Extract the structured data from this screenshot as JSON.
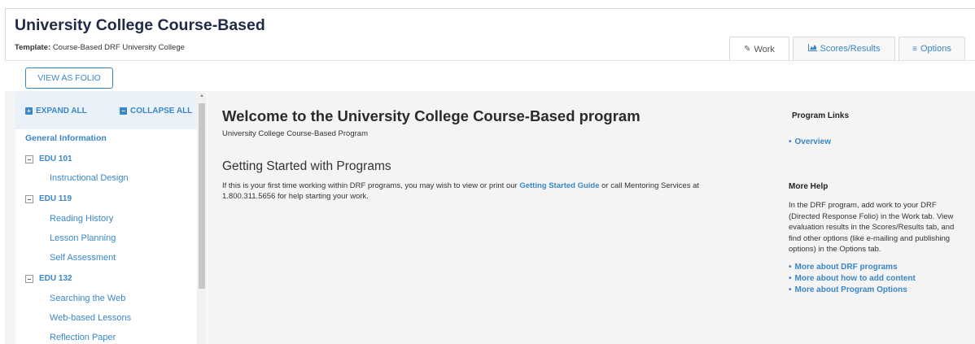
{
  "header": {
    "title": "University College Course-Based",
    "template_label": "Template:",
    "template_value": "Course-Based DRF University College"
  },
  "tabs": [
    {
      "icon": "edit-icon",
      "label": "Work"
    },
    {
      "icon": "chart-icon",
      "label": "Scores/Results"
    },
    {
      "icon": "menu-icon",
      "label": "Options"
    }
  ],
  "toolbar": {
    "view_folio": "VIEW AS FOLIO"
  },
  "sidebar": {
    "expand_all": "EXPAND ALL",
    "collapse_all": "COLLAPSE ALL",
    "general": "General Information",
    "courses": [
      {
        "code": "EDU 101",
        "items": [
          "Instructional Design"
        ]
      },
      {
        "code": "EDU 119",
        "items": [
          "Reading History",
          "Lesson Planning",
          "Self Assessment"
        ]
      },
      {
        "code": "EDU 132",
        "items": [
          "Searching the Web",
          "Web-based Lessons",
          "Reflection Paper"
        ]
      }
    ]
  },
  "main": {
    "welcome": "Welcome to the University College Course-Based program",
    "subtitle": "University College Course-Based Program",
    "getting_started": "Getting Started with Programs",
    "para_before": "If this is your first time working within DRF programs, you may wish to view or print our ",
    "guide_link": "Getting Started Guide",
    "para_after": " or call Mentoring Services at 1.800.311.5656 for help starting your work."
  },
  "right": {
    "program_links": "Program Links",
    "overview": "Overview",
    "more_help": "More Help",
    "help_text": "In the DRF program, add work to your DRF (Directed Response Folio) in the Work tab. View evaluation results in the Scores/Results tab, and find other options (like e-mailing and publishing options) in the Options tab.",
    "links": [
      "More about DRF programs",
      "More about how to add content",
      "More about Program Options"
    ]
  },
  "colors": {
    "accent": "#3a87c8",
    "title": "#1f2a44",
    "panel_bg": "#f4f4f4",
    "sidebar_head": "#eaf1f8"
  }
}
